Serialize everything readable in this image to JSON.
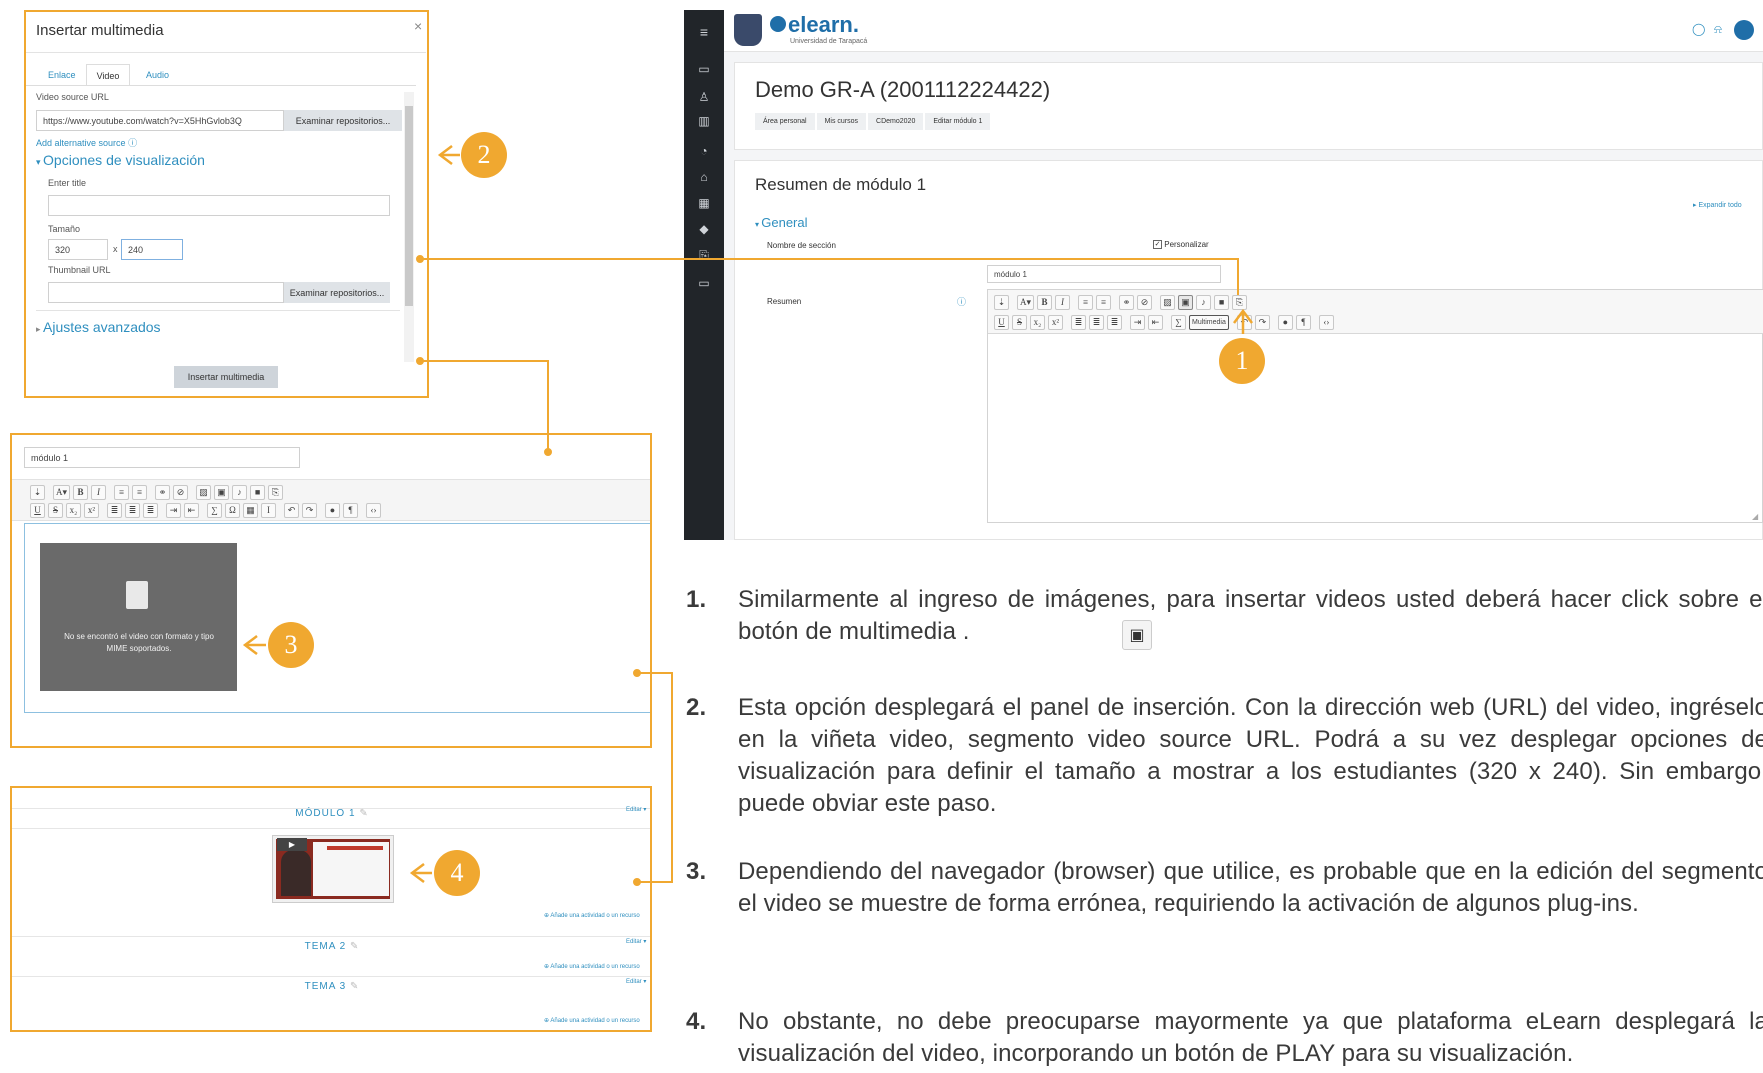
{
  "dialog": {
    "title": "Insertar multimedia",
    "close": "×",
    "tabs": [
      "Enlace",
      "Video",
      "Audio"
    ],
    "video_source_label": "Video source URL",
    "video_url": "https://www.youtube.com/watch?v=X5HhGvlob3Q",
    "browse_repos": "Examinar repositorios...",
    "add_alt_source": "Add alternative source",
    "display_options": "Opciones de visualización",
    "enter_title": "Enter title",
    "size_label": "Tamaño",
    "width": "320",
    "x": "x",
    "height": "240",
    "thumbnail_label": "Thumbnail URL",
    "browse_repos2": "Examinar repositorios...",
    "advanced": "Ajustes avanzados",
    "insert_button": "Insertar multimedia"
  },
  "editor_frame": {
    "field_value": "módulo 1",
    "video_error": "No se encontró el video con formato y tipo MIME soportados."
  },
  "course_frame": {
    "modulo_title": "MÓDULO 1",
    "editar": "Editar",
    "add_activity": "Añade una actividad o un recurso",
    "tema2": "TEMA 2",
    "tema3": "TEMA 3"
  },
  "moodle": {
    "brand": "elearn.",
    "brand_sub": "Universidad de Tarapacá",
    "course_title": "Demo GR-A (2001112224422)",
    "breadcrumbs": [
      "Área personal",
      "Mis cursos",
      "CDemo2020",
      "Editar módulo 1"
    ],
    "section_heading": "Resumen de módulo 1",
    "expand_all": "Expandir todo",
    "general": "General",
    "section_name_label": "Nombre de sección",
    "customize": "Personalizar",
    "section_name_value": "módulo 1",
    "summary_label": "Resumen",
    "multimedia_tooltip": "Multimedia"
  },
  "callouts": [
    "1",
    "2",
    "3",
    "4"
  ],
  "instructions": [
    {
      "num": "1.",
      "text": "Similarmente al ingreso de imágenes, para insertar videos usted deberá hacer click sobre el botón de multimedia ."
    },
    {
      "num": "2.",
      "text": "Esta opción desplegará el panel de inserción. Con la dirección web (URL) del video, ingréselo en la viñeta video, segmento video source URL. Podrá a su vez desplegar opciones de visualización para definir el tamaño a mostrar a los estudiantes (320 x 240). Sin embargo, puede obviar este paso."
    },
    {
      "num": "3.",
      "text": "Dependiendo del navegador (browser) que utilice, es probable que en la edición del segmento el video se muestre de forma errónea, requiriendo la activación de algunos plug-ins."
    },
    {
      "num": "4.",
      "text": "No obstante, no debe preocuparse mayormente ya que plataforma eLearn desplegará la visualización del video, incorporando un botón de PLAY para su visualización."
    }
  ],
  "colors": {
    "accent": "#f0a830",
    "link": "#2f8fbf",
    "sidebar": "#212529"
  }
}
